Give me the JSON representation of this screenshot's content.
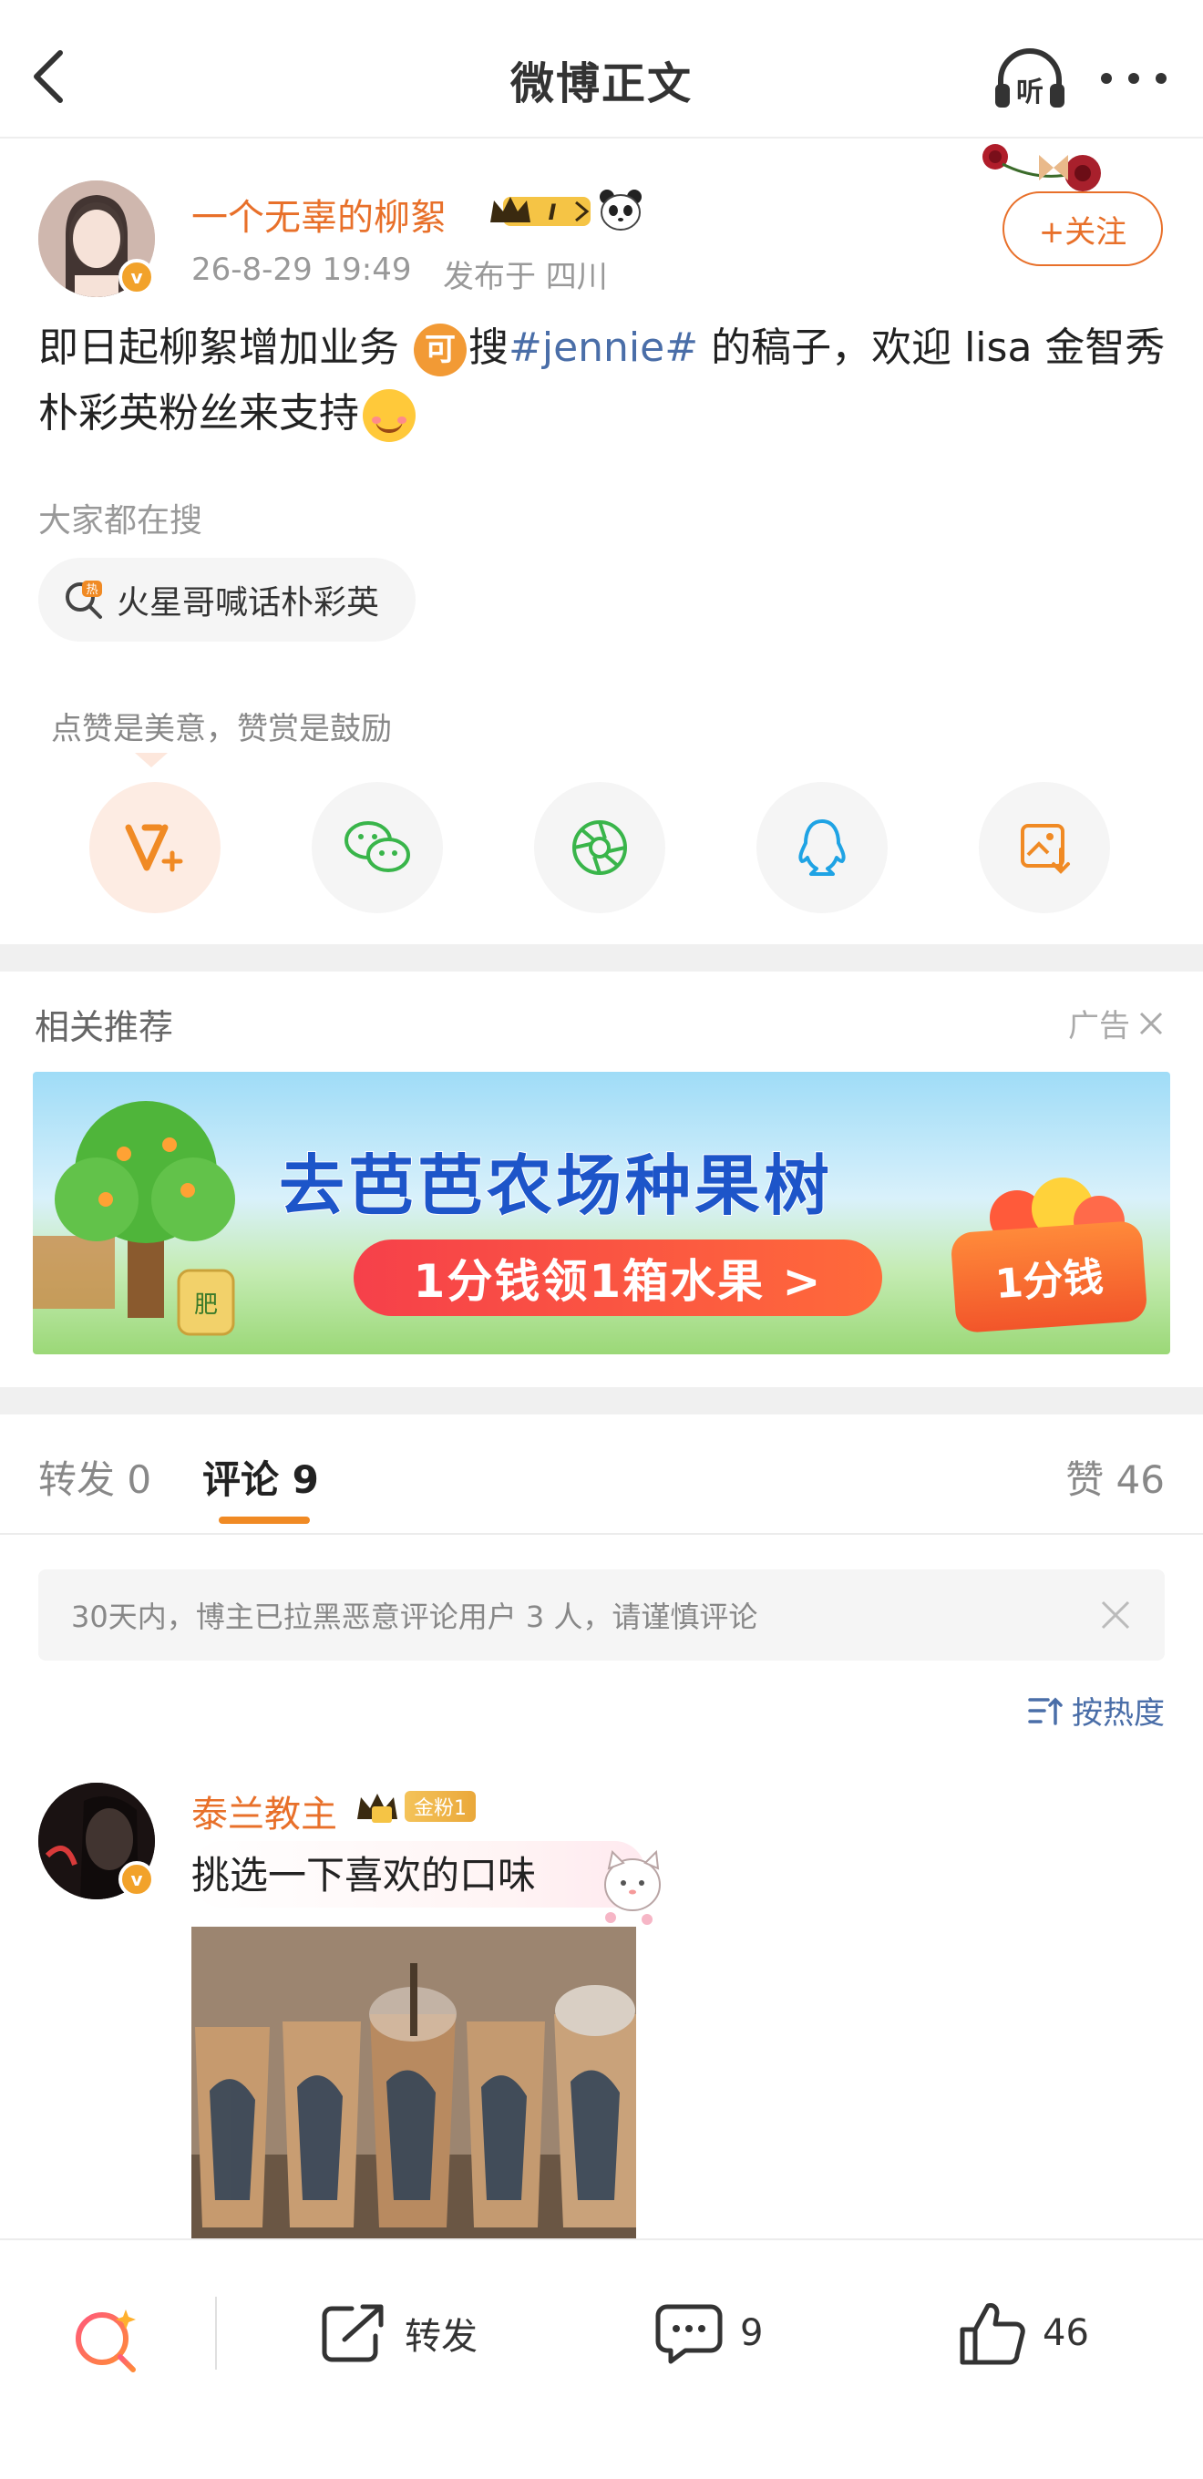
{
  "nav": {
    "title": "微博正文",
    "listen_label": "听"
  },
  "author": {
    "name": "一个无辜的柳絮",
    "badge_text": "I",
    "time": "26-8-29 19:49",
    "from": "发布于 四川",
    "follow_label": "+关注",
    "verified_mark": "v"
  },
  "post": {
    "text_before": "即日起柳絮增加业务 ",
    "coin_emoji": "可",
    "text_search": "搜",
    "topic": "#jennie#",
    "text_after": " 的稿子，欢迎 lisa 金智秀 朴彩英粉丝来支持"
  },
  "search_hint": {
    "label": "大家都在搜",
    "chip": "火星哥喊话朴彩英",
    "chip_icon_text": "热"
  },
  "like_tip": "点赞是美意，赞赏是鼓励",
  "share": {
    "items": [
      "v-plus-icon",
      "wechat-icon",
      "moments-icon",
      "qq-icon",
      "save-image-icon"
    ]
  },
  "recommend": {
    "title": "相关推荐",
    "ad_label": "广告",
    "banner_title": "去芭芭农场种果树",
    "banner_button": "1分钱领1箱水果 >",
    "banner_basket": "1分钱",
    "banner_sack": "肥"
  },
  "tabs": {
    "repost": "转发 0",
    "comment": "评论 9",
    "like": "赞 46"
  },
  "notice": "30天内，博主已拉黑恶意评论用户 3 人，请谨慎评论",
  "sort_label": "按热度",
  "comment": {
    "name": "泰兰教主",
    "fan_badge": "金粉1",
    "text": "挑选一下喜欢的口味"
  },
  "bottom": {
    "repost": "转发",
    "comment_count": "9",
    "like_count": "46"
  },
  "colors": {
    "accent_orange": "#e8702a",
    "link_blue": "#4a6ea8",
    "background_gap": "#f0f0f0"
  }
}
